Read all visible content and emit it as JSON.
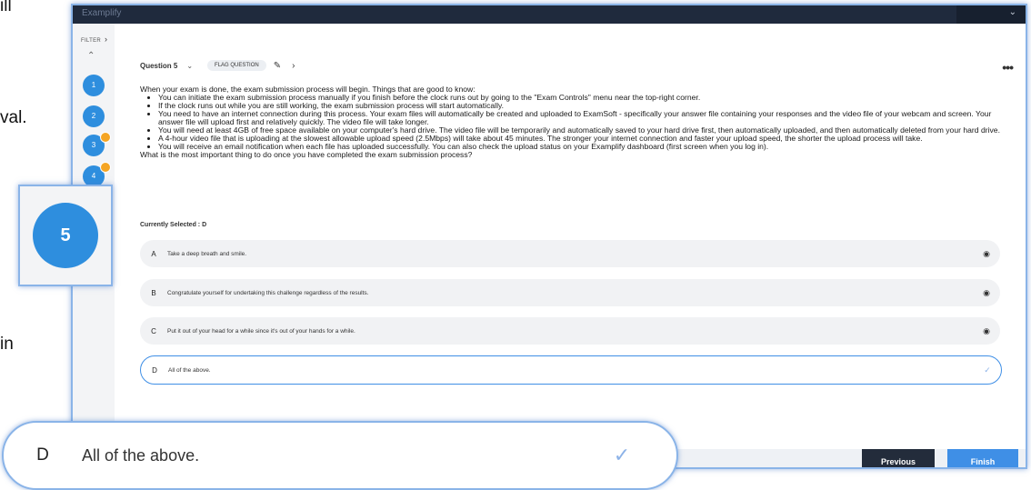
{
  "background_fragments": {
    "frag1": "ill",
    "frag2": "val.",
    "frag3": "in"
  },
  "topbar": {
    "title": "Examplify"
  },
  "sidebar": {
    "filter_label": "FILTER",
    "questions": [
      {
        "num": "1",
        "flagged": false
      },
      {
        "num": "2",
        "flagged": false
      },
      {
        "num": "3",
        "flagged": true
      },
      {
        "num": "4",
        "flagged": true
      }
    ]
  },
  "question": {
    "label": "Question 5",
    "flag_label": "FLAG QUESTION",
    "intro": "When your exam is done, the exam submission process will begin. Things that are good to know:",
    "bullets": [
      "You can initiate the exam submission process manually if you finish before the clock runs out by going to the \"Exam Controls\" menu near the top-right corner.",
      "If the clock runs out while you are still working, the exam submission process will start automatically.",
      "You need to have an internet connection during this process. Your exam files will automatically be created and uploaded to ExamSoft - specifically your answer file containing your responses and the video file of your webcam and screen. Your answer file will upload first and relatively quickly. The video file will take longer.",
      "You will need at least 4GB of free space available on your computer's hard drive. The video file will be temporarily and automatically saved to your hard drive first, then automatically uploaded, and then automatically deleted from your hard drive.",
      "A 4-hour video file that is uploading at the slowest allowable upload speed (2.5Mbps) will take about 45 minutes. The stronger your internet connection and faster your upload speed, the shorter the upload process will take.",
      "You will receive an email notification when each file has uploaded successfully. You can also check the upload status on your Examplify dashboard (first screen when you log in)."
    ],
    "prompt": "What is the most important thing to do once you have completed the exam submission process?",
    "currently_selected": "Currently Selected : D",
    "options": [
      {
        "letter": "A",
        "text": "Take a deep breath and smile."
      },
      {
        "letter": "B",
        "text": "Congratulate yourself for undertaking this challenge regardless of the results."
      },
      {
        "letter": "C",
        "text": "Put it out of your head for a while since it's out of your hands for a while."
      },
      {
        "letter": "D",
        "text": "All of the above."
      }
    ],
    "selected_letter": "D"
  },
  "footer": {
    "previous_label": "Previous",
    "finish_label": "Finish"
  },
  "zoom": {
    "question_number": "5",
    "selected_letter": "D",
    "selected_text": "All of the above."
  },
  "colors": {
    "accent": "#2e8ede",
    "flag": "#f5a524",
    "dark": "#1f2a3d"
  },
  "icons": {
    "flag": "flag-icon",
    "edit": "pencil-icon",
    "more": "kebab-icon",
    "eye": "eye-icon",
    "check": "check-icon"
  }
}
